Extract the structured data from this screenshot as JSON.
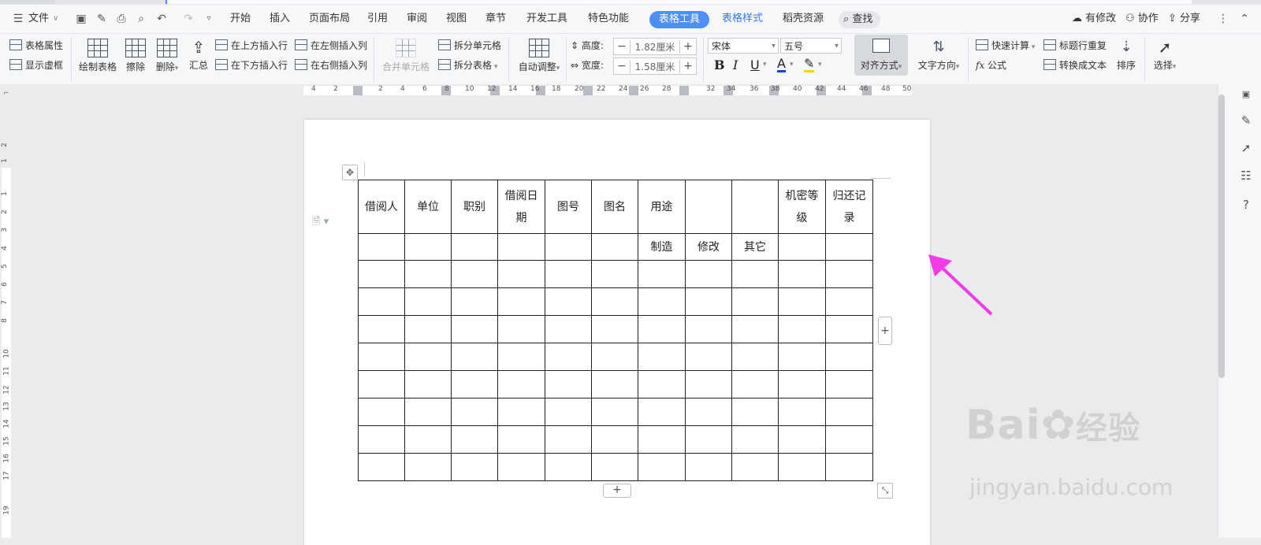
{
  "menubar": {
    "file": "文件",
    "tabs": [
      "开始",
      "插入",
      "页面布局",
      "引用",
      "审阅",
      "视图",
      "章节",
      "开发工具",
      "特色功能"
    ],
    "active_tab": "表格工具",
    "tab_table_style": "表格样式",
    "tab_resources": "稻壳资源",
    "search": "查找",
    "modified": "有修改",
    "collab": "协作",
    "share": "分享"
  },
  "ribbon": {
    "table_props": "表格属性",
    "show_gridlines": "显示虚框",
    "draw_table": "绘制表格",
    "erase": "擦除",
    "delete": "删除",
    "summary": "汇总",
    "insert_above": "在上方插入行",
    "insert_below": "在下方插入行",
    "insert_left": "在左侧插入列",
    "insert_right": "在右侧插入列",
    "merge_cells": "合并单元格",
    "split_cells": "拆分单元格",
    "split_table": "拆分表格",
    "autofit": "自动调整",
    "height_label": "高度:",
    "height_value": "1.82厘米",
    "width_label": "宽度:",
    "width_value": "1.58厘米",
    "font": "宋体",
    "font_size": "五号",
    "align": "对齐方式",
    "text_direction": "文字方向",
    "quick_calc": "快速计算",
    "formula": "公式",
    "repeat_header": "标题行重复",
    "to_text": "转换成文本",
    "sort": "排序",
    "select": "选择"
  },
  "ruler_h": [
    "4",
    "2",
    "2",
    "4",
    "6",
    "8",
    "10",
    "12",
    "14",
    "16",
    "18",
    "20",
    "22",
    "24",
    "26",
    "28",
    "32",
    "34",
    "36",
    "38",
    "40",
    "42",
    "44",
    "46",
    "48",
    "50"
  ],
  "ruler_v": [
    "2",
    "1",
    "1",
    "2",
    "3",
    "4",
    "5",
    "6",
    "7",
    "8",
    "10",
    "11",
    "12",
    "13",
    "14",
    "15",
    "16",
    "17",
    "19"
  ],
  "table": {
    "header_row1": [
      "借阅人",
      "单位",
      "职别",
      "借阅日期",
      "图号",
      "图名",
      "用途",
      "",
      "",
      "机密等级",
      "归还记录"
    ],
    "header_row2": [
      "",
      "",
      "",
      "",
      "",
      "",
      "制造",
      "修改",
      "其它",
      "",
      ""
    ],
    "empty_rows": 8
  },
  "watermark": {
    "brand": "Bai",
    "brand_tail": "经验",
    "url": "jingyan.baidu.com"
  },
  "colors": {
    "accent": "#4e8ef7",
    "arrow": "#f03ce6"
  }
}
